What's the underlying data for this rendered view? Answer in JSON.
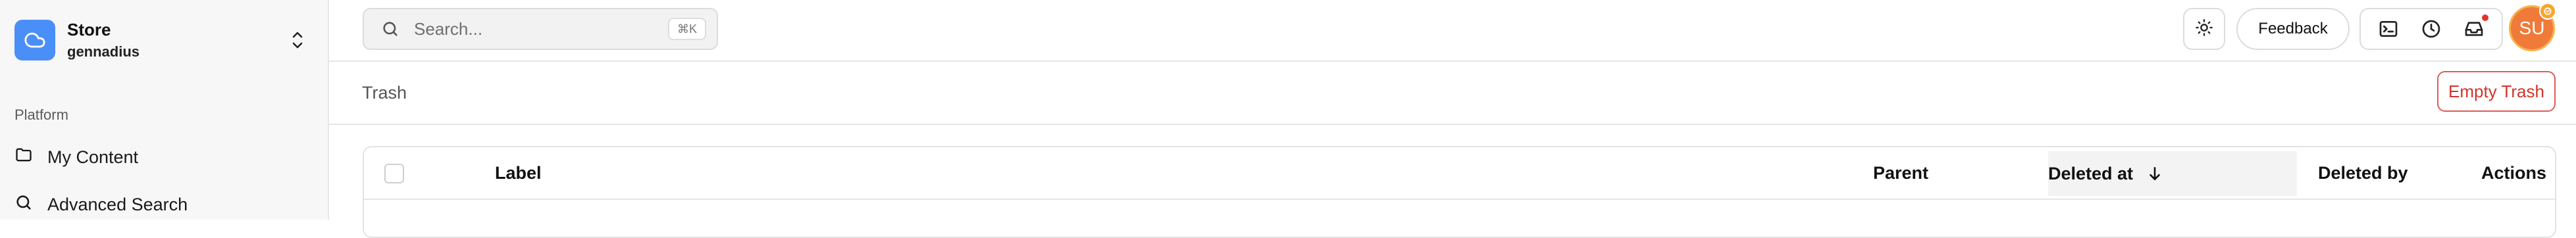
{
  "sidebar": {
    "store_name": "Store",
    "store_user": "gennadius",
    "section_label": "Platform",
    "items": [
      {
        "label": "My Content",
        "icon": "folder-icon"
      },
      {
        "label": "Advanced Search",
        "icon": "search-icon"
      }
    ]
  },
  "header": {
    "search_placeholder": "Search...",
    "search_shortcut": "⌘K",
    "feedback_label": "Feedback",
    "avatar_initials": "SU",
    "notification_color": "#e0342c"
  },
  "page": {
    "title": "Trash",
    "empty_trash_label": "Empty Trash"
  },
  "table": {
    "columns": [
      "Label",
      "Parent",
      "Deleted at",
      "Deleted by",
      "Actions"
    ],
    "sorted_column": "Deleted at",
    "sort_direction": "descending"
  },
  "colors": {
    "brand": "#4a8ff7",
    "danger": "#d2342b",
    "avatar": "#ef7a3a"
  }
}
